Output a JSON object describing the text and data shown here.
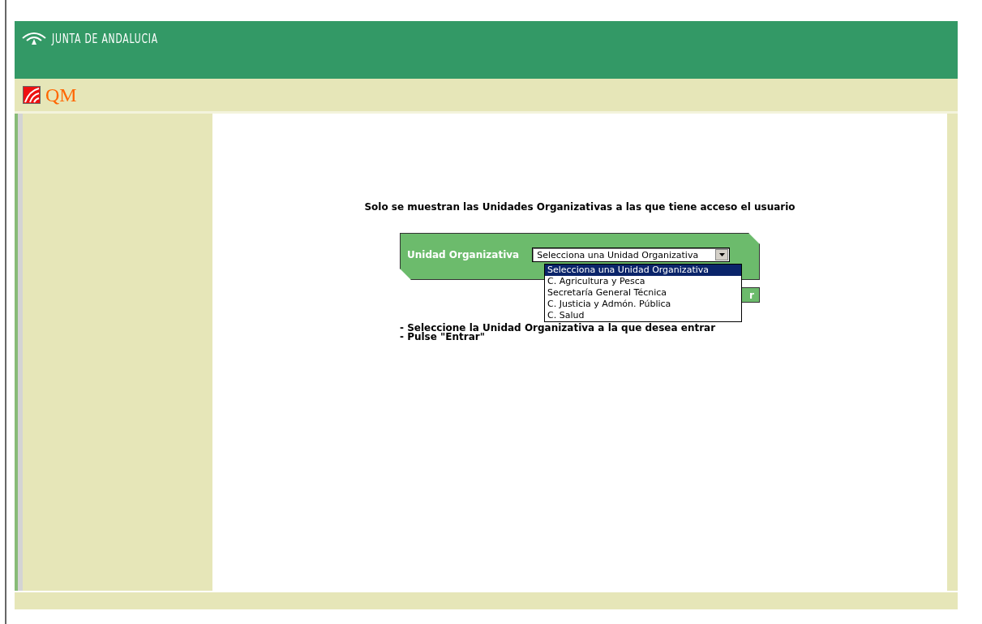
{
  "header": {
    "brand": "JUNTA DE ANDALUCIA",
    "app_name": "QM"
  },
  "notice": "Solo se muestran las Unidades Organizativas a las que tiene acceso el usuario",
  "form": {
    "label": "Unidad Organizativa",
    "select_value": "Selecciona una Unidad Organizativa",
    "expanded": true,
    "options": [
      {
        "label": "Selecciona una Unidad Organizativa",
        "selected": true
      },
      {
        "label": "C. Agricultura y Pesca",
        "selected": false
      },
      {
        "label": "Secretaría General Técnica",
        "selected": false
      },
      {
        "label": "C. Justicia y Admón. Pública",
        "selected": false
      },
      {
        "label": "C. Salud",
        "selected": false
      }
    ],
    "button": "r"
  },
  "instructions": [
    "- Seleccione la Unidad Organizativa a la que desea entrar",
    "- Pulse \"Entrar\""
  ]
}
